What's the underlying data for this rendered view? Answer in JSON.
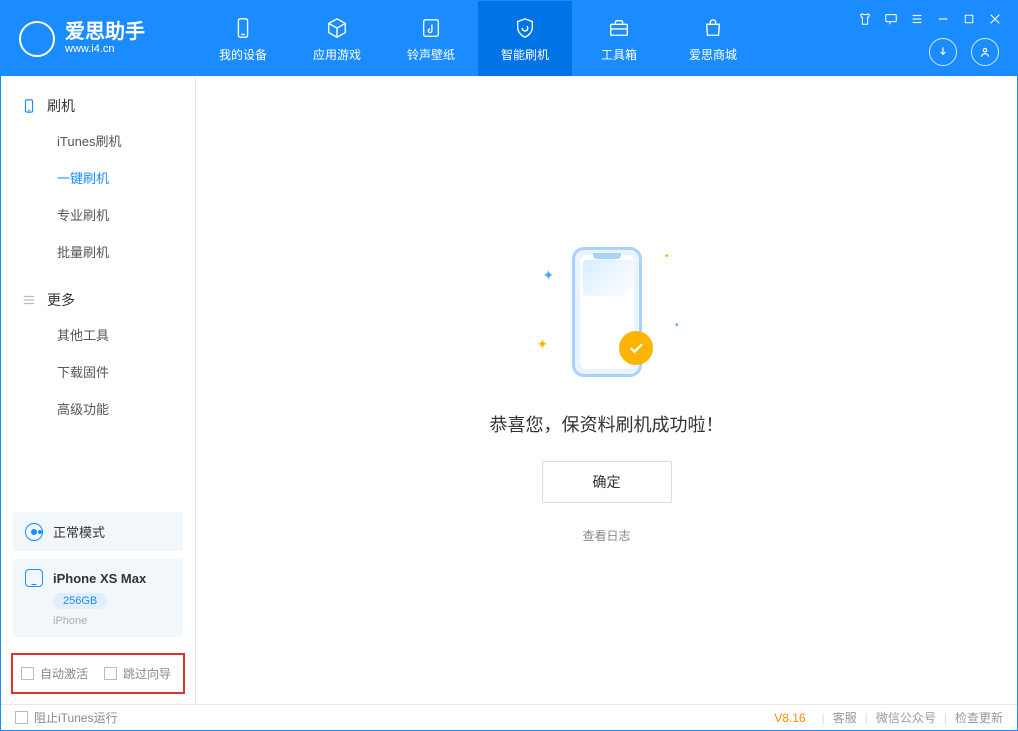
{
  "app": {
    "title": "爱思助手",
    "subtitle": "www.i4.cn"
  },
  "tabs": [
    {
      "label": "我的设备"
    },
    {
      "label": "应用游戏"
    },
    {
      "label": "铃声壁纸"
    },
    {
      "label": "智能刷机"
    },
    {
      "label": "工具箱"
    },
    {
      "label": "爱思商城"
    }
  ],
  "sidebar": {
    "group1": {
      "title": "刷机",
      "items": [
        "iTunes刷机",
        "一键刷机",
        "专业刷机",
        "批量刷机"
      ]
    },
    "group2": {
      "title": "更多",
      "items": [
        "其他工具",
        "下载固件",
        "高级功能"
      ]
    }
  },
  "mode": {
    "label": "正常模式"
  },
  "device": {
    "name": "iPhone XS Max",
    "storage": "256GB",
    "type": "iPhone"
  },
  "options": {
    "auto_activate": "自动激活",
    "skip_guide": "跳过向导"
  },
  "main": {
    "success": "恭喜您，保资料刷机成功啦！",
    "ok": "确定",
    "log": "查看日志"
  },
  "footer": {
    "stop_itunes": "阻止iTunes运行",
    "version": "V8.16",
    "links": [
      "客服",
      "微信公众号",
      "检查更新"
    ]
  }
}
